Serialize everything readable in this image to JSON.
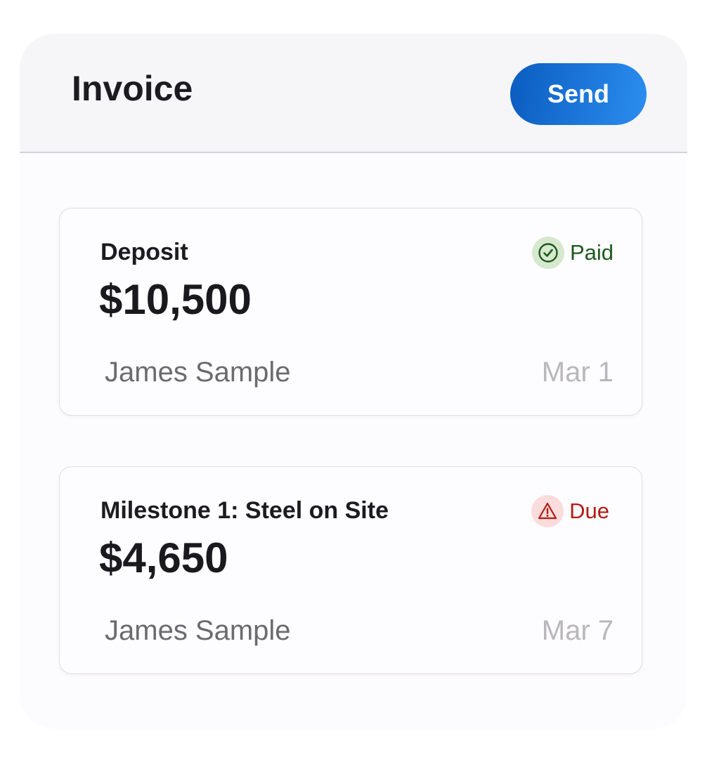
{
  "header": {
    "title": "Invoice",
    "send_label": "Send"
  },
  "invoices": [
    {
      "label": "Deposit",
      "amount": "$10,500",
      "client": "James Sample",
      "date": "Mar 1",
      "status": "Paid",
      "status_icon": "check-circle-icon",
      "status_color": "#1c5a1c"
    },
    {
      "label": "Milestone 1: Steel on Site",
      "amount": "$4,650",
      "client": "James Sample",
      "date": "Mar 7",
      "status": "Due",
      "status_icon": "warning-triangle-icon",
      "status_color": "#b31b14"
    }
  ],
  "colors": {
    "accent": "#1a74dc",
    "paid": "#1c5a1c",
    "due": "#b31b14"
  }
}
